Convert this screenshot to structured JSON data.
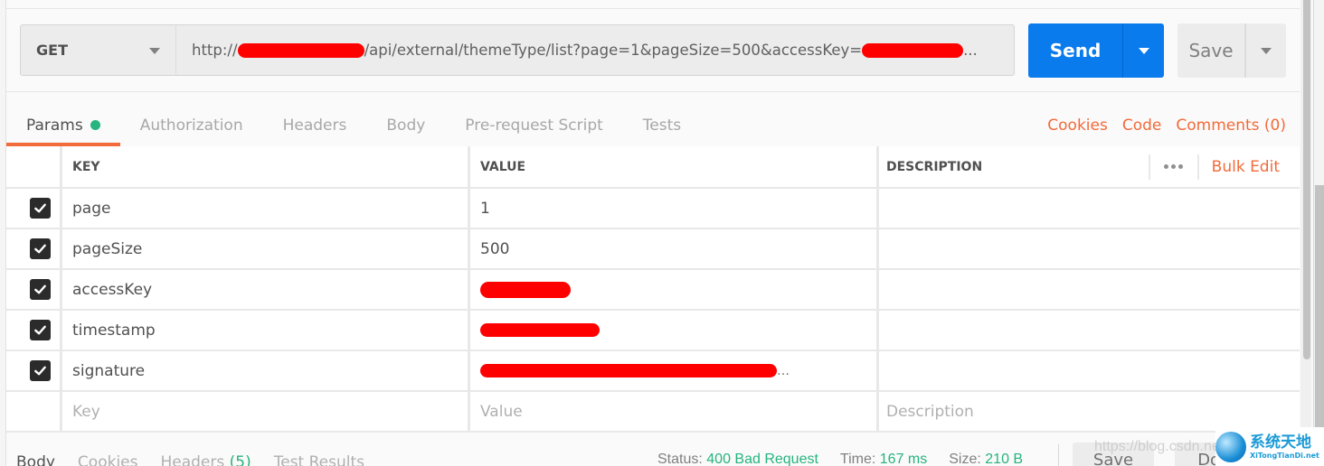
{
  "request": {
    "method": "GET",
    "url_prefix": "http://",
    "url_middle": "/api/external/themeType/list?page=1&pageSize=500&accessKey=",
    "url_suffix": "...",
    "send_label": "Send",
    "save_label": "Save"
  },
  "tabs": [
    {
      "label": "Params",
      "active": true,
      "indicator": true
    },
    {
      "label": "Authorization"
    },
    {
      "label": "Headers"
    },
    {
      "label": "Body"
    },
    {
      "label": "Pre-request Script"
    },
    {
      "label": "Tests"
    }
  ],
  "tab_links": {
    "cookies": "Cookies",
    "code": "Code",
    "comments": "Comments (0)"
  },
  "params_table": {
    "headers": {
      "key": "KEY",
      "value": "VALUE",
      "description": "DESCRIPTION"
    },
    "bulk_edit": "Bulk Edit",
    "rows": [
      {
        "checked": true,
        "key": "page",
        "value": "1",
        "description": ""
      },
      {
        "checked": true,
        "key": "pageSize",
        "value": "500",
        "description": ""
      },
      {
        "checked": true,
        "key": "accessKey",
        "value": "[redacted]",
        "description": ""
      },
      {
        "checked": true,
        "key": "timestamp",
        "value": "[redacted]",
        "description": ""
      },
      {
        "checked": true,
        "key": "signature",
        "value": "[redacted]...",
        "description": ""
      }
    ],
    "new_row": {
      "key_placeholder": "Key",
      "value_placeholder": "Value",
      "description_placeholder": "Description"
    }
  },
  "response": {
    "tabs": [
      {
        "label": "Body",
        "active": true
      },
      {
        "label": "Cookies"
      },
      {
        "label": "Headers",
        "count": "(5)"
      },
      {
        "label": "Test Results"
      }
    ],
    "status_label": "Status:",
    "status_value": "400 Bad Request",
    "time_label": "Time:",
    "time_value": "167 ms",
    "size_label": "Size:",
    "size_value": "210 B",
    "save_label": "Save",
    "download_label": "Dow"
  },
  "watermark": {
    "url": "https://blog.csdn.ne",
    "brand_cn": "系统天地",
    "brand_en": "XiTongTianDi.net"
  },
  "colors": {
    "accent": "#f26b3a",
    "send_blue": "#097bed",
    "success_green": "#26b47f"
  }
}
